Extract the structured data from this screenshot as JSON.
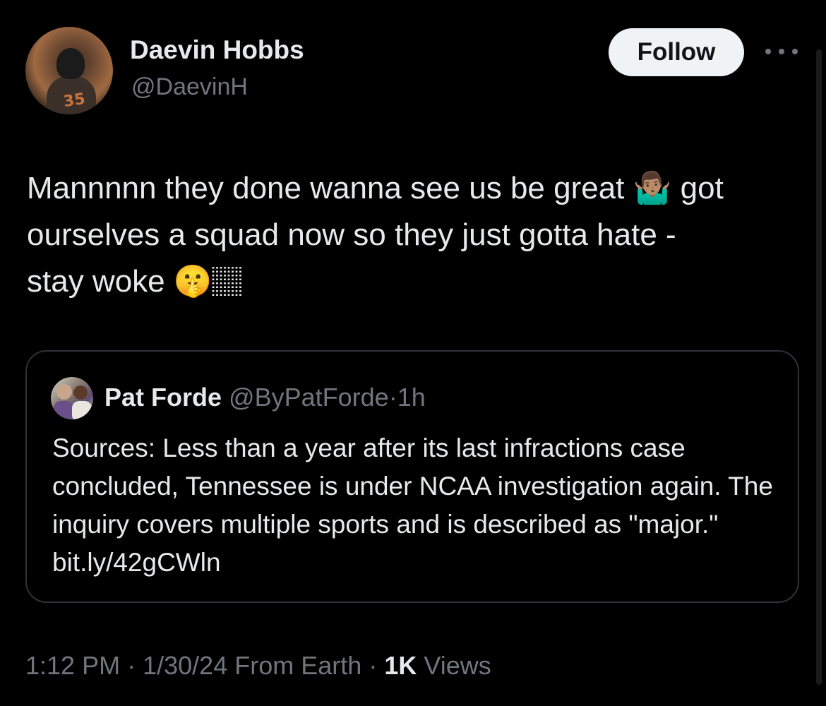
{
  "author": {
    "display_name": "Daevin Hobbs",
    "handle": "@DaevinH",
    "avatar_icon": "profile-photo-football-player"
  },
  "actions": {
    "follow_label": "Follow",
    "more_icon": "ellipsis-icon"
  },
  "tweet": {
    "line1": "Mannnnn they done wanna see us be great 🤷🏽‍♂️ got",
    "line2": "ourselves a squad now so they just gotta hate -",
    "line3": "stay woke 🤫🏽"
  },
  "quote": {
    "display_name": "Pat Forde",
    "handle": "@ByPatForde",
    "separator": "·",
    "time": "1h",
    "text": "Sources: Less than a year after its last infractions case concluded, Tennessee is under NCAA investigation again. The inquiry covers multiple sports and is described as \"major.\" bit.ly/42gCWln"
  },
  "meta": {
    "time": "1:12 PM",
    "sep1": "·",
    "date": "1/30/24",
    "source": "From Earth",
    "sep2": "·",
    "views_count": "1K",
    "views_label": "Views"
  },
  "colors": {
    "background": "#000000",
    "text": "#e7e9ea",
    "secondary": "#71767b",
    "border": "#2f3336",
    "button_bg": "#eff3f4"
  }
}
